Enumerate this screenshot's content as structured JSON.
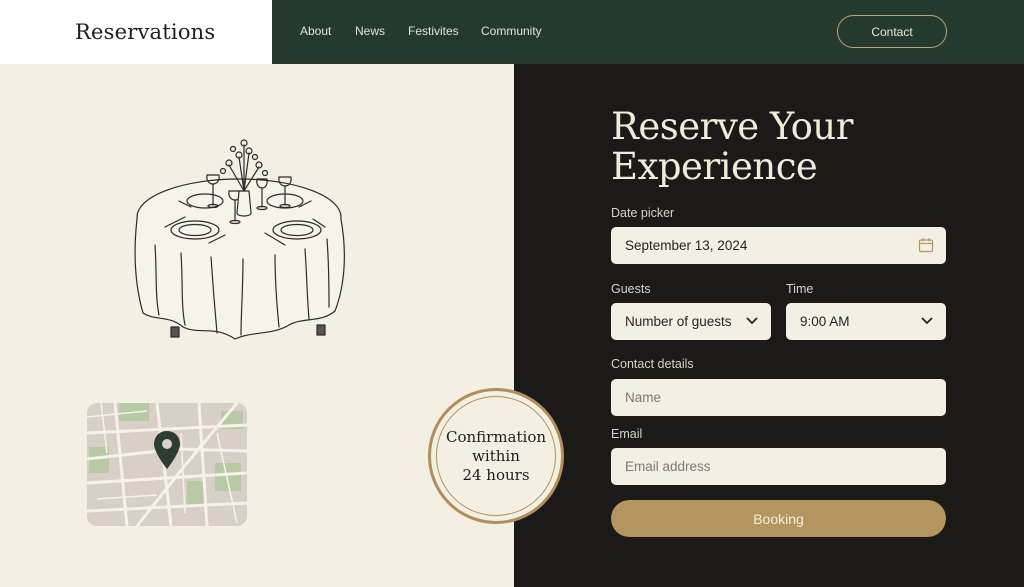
{
  "brand": {
    "title": "Reservations"
  },
  "nav": {
    "items": [
      "About",
      "News",
      "Festivites",
      "Community"
    ],
    "contact_label": "Contact"
  },
  "hero": {
    "heading_line1": "Reserve Your",
    "heading_line2": "Experience"
  },
  "form": {
    "date_label": "Date picker",
    "date_value": "September 13, 2024",
    "guests_label": "Guests",
    "guests_value": "Number of guests",
    "time_label": "Time",
    "time_value": "9:00 AM",
    "contact_label": "Contact details",
    "name_placeholder": "Name",
    "email_label": "Email",
    "email_placeholder": "Email address",
    "submit_label": "Booking"
  },
  "badge": {
    "line1": "Confirmation",
    "line2": "within",
    "line3": "24 hours"
  },
  "colors": {
    "nav_bg": "#253a2f",
    "panel_dark": "#1b1a18",
    "cream": "#f3efe3",
    "accent_gold": "#b4945f",
    "map_pin": "#2e3d34"
  },
  "icons": {
    "date": "calendar-icon",
    "select": "chevron-down-icon",
    "map": "map-pin-icon"
  }
}
